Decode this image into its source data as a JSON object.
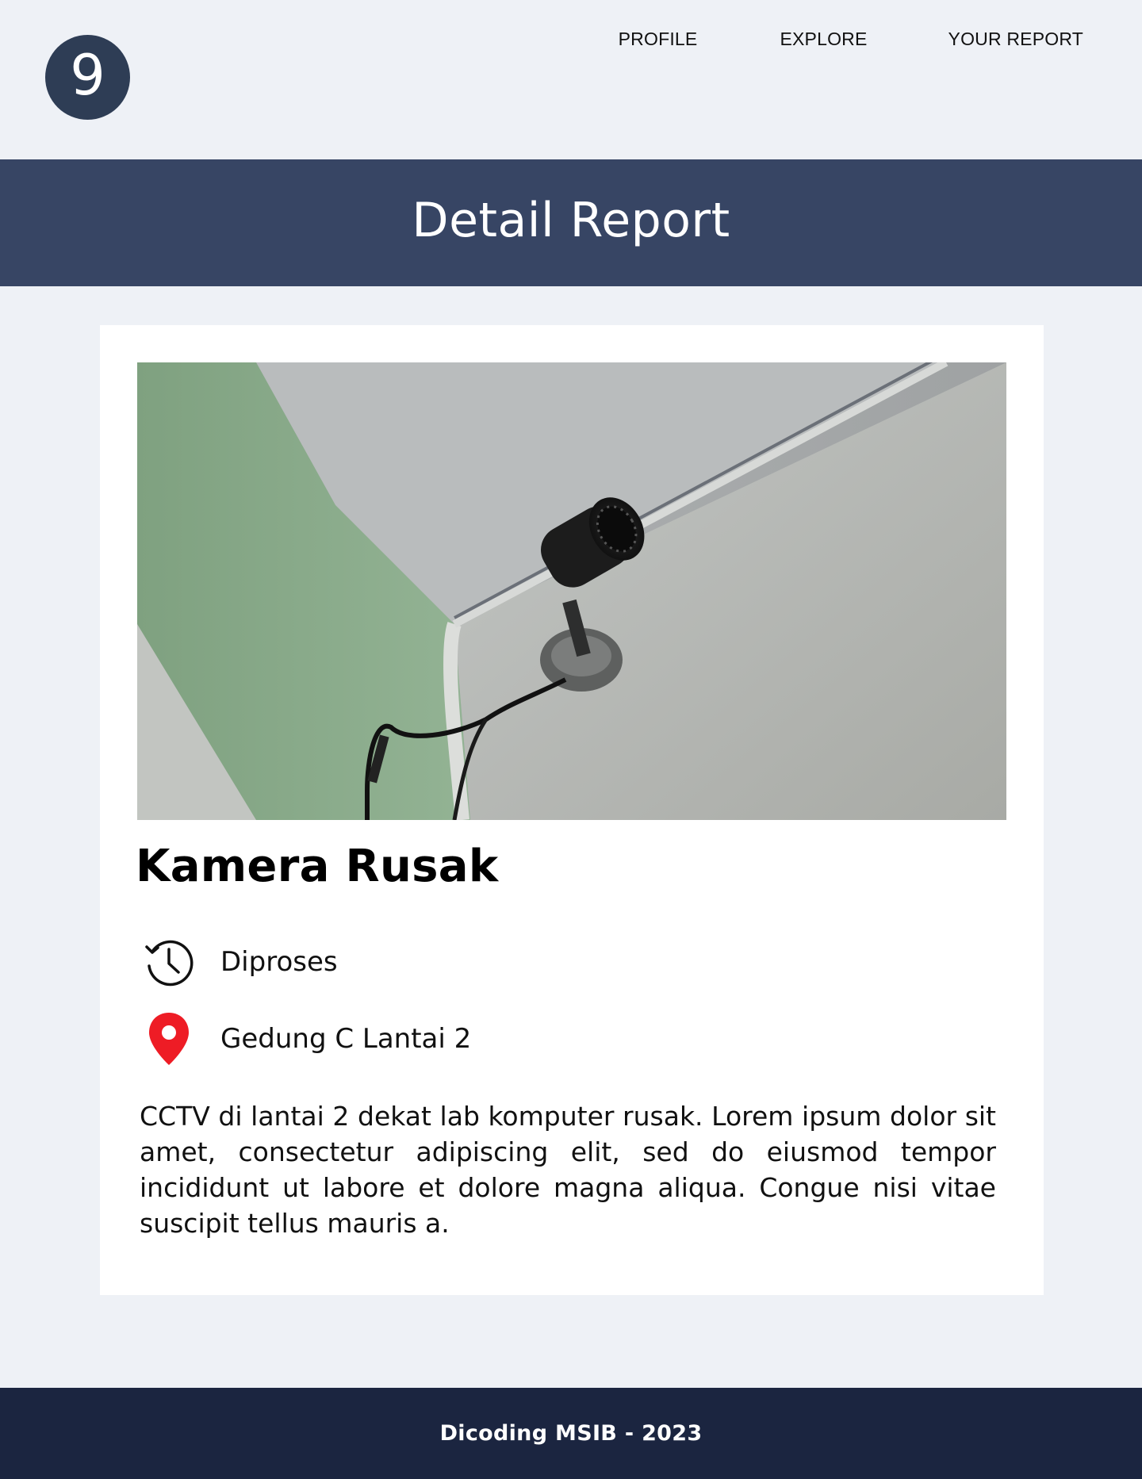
{
  "header": {
    "logo_text": "9",
    "nav": [
      {
        "label": "PROFILE"
      },
      {
        "label": "EXPLORE"
      },
      {
        "label": "YOUR REPORT"
      }
    ]
  },
  "banner": {
    "title": "Detail Report"
  },
  "report": {
    "image_alt": "CCTV camera mounted on ceiling corner",
    "title": "Kamera Rusak",
    "status": "Diproses",
    "status_icon": "history-icon",
    "location": "Gedung C Lantai 2",
    "location_icon": "map-pin-icon",
    "description": "CCTV di lantai 2 dekat lab komputer rusak. Lorem ipsum dolor sit amet, consectetur adipiscing elit, sed do eiusmod tempor incididunt ut labore et dolore magna aliqua. Congue nisi vitae suscipit tellus mauris a."
  },
  "footer": {
    "text": "Dicoding MSIB - 2023"
  },
  "colors": {
    "page_bg": "#eef1f6",
    "logo_bg": "#2e3d55",
    "banner_bg": "#374564",
    "footer_bg": "#1b2540",
    "pin": "#ee1c25"
  }
}
